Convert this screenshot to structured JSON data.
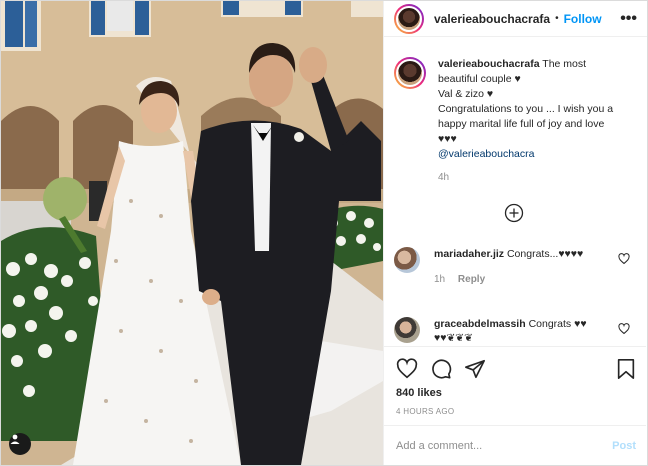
{
  "post": {
    "username": "valerieabouchacrafa",
    "follow_label": "Follow",
    "more_label": "•••",
    "dot": "•"
  },
  "caption": {
    "username": "valerieabouchacrafa",
    "line1": "The most beautiful couple ♥",
    "line2": "Val & zizo ♥",
    "line3": "Congratulations to you ... I wish you a happy marital life full of joy and love",
    "hearts": "♥♥♥",
    "mention": "@valerieabouchacra",
    "time": "4h"
  },
  "comments": [
    {
      "username": "mariadaher.jiz",
      "text": "Congrats...♥♥♥♥",
      "time": "1h",
      "reply_label": "Reply"
    },
    {
      "username": "graceabdelmassih",
      "text": "Congrats ♥♥ ♥♥❦❦❦",
      "time": "",
      "reply_label": ""
    }
  ],
  "actions": {
    "likes": "840 likes",
    "posted_ago": "4 HOURS AGO"
  },
  "add_comment": {
    "placeholder": "Add a comment...",
    "post_label": "Post"
  },
  "icons": {
    "like": "heart-icon",
    "comment": "comment-icon",
    "share": "share-icon",
    "save": "bookmark-icon",
    "more": "more-options-icon",
    "load_more": "plus-circle-icon",
    "user_tag": "user-tag-icon"
  },
  "colors": {
    "follow_blue": "#0095f6",
    "post_disabled": "#b2dffc",
    "meta_gray": "#8e8e8e"
  }
}
